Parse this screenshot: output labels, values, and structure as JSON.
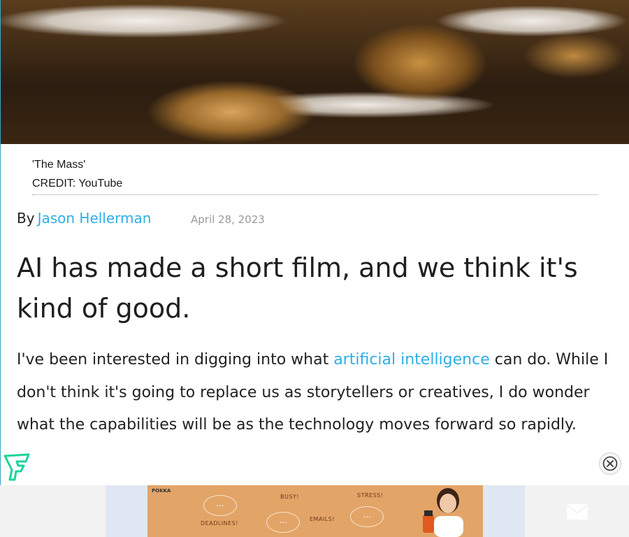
{
  "hero": {
    "image": "abstract-sculpture-image"
  },
  "caption": {
    "title": "'The Mass'",
    "credit": "CREDIT: YouTube"
  },
  "byline": {
    "prefix": "By",
    "author": "Jason Hellerman",
    "date": "April 28, 2023"
  },
  "article": {
    "headline": "AI has made a short film, and we think it's kind of good.",
    "body_before_link": "I've been interested in digging into what ",
    "body_link": "artificial intelligence",
    "body_after_link": " can do. While I don't think it's going to replace us as storytellers or creatives, I do wonder what the capabilities will be as the technology moves forward so rapidly."
  },
  "ad": {
    "brand": "POKKA",
    "words": [
      "BUSY!",
      "STRESS!",
      "DEADLINES!",
      "EMAILS!"
    ],
    "bubble_text": "..."
  },
  "icons": {
    "logo": "brand-logo-icon",
    "close": "close-icon",
    "mail": "mail-icon"
  },
  "colors": {
    "link": "#2eaee6",
    "logo": "#1ed39a",
    "ad_background": "#e3a468"
  }
}
